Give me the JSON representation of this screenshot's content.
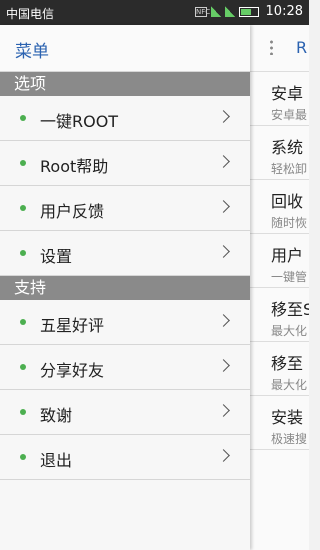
{
  "status_bar": {
    "carrier": "中国电信",
    "nfc": "NFC",
    "time": "10:28"
  },
  "drawer": {
    "title": "菜单",
    "sections": [
      {
        "label": "选项",
        "items": [
          "一键ROOT",
          "Root帮助",
          "用户反馈",
          "设置"
        ]
      },
      {
        "label": "支持",
        "items": [
          "五星好评",
          "分享好友",
          "致谢",
          "退出"
        ]
      }
    ]
  },
  "content": {
    "title": "R",
    "items": [
      {
        "title": "安卓",
        "subtitle": "安卓最"
      },
      {
        "title": "系统",
        "subtitle": "轻松卸"
      },
      {
        "title": "回收",
        "subtitle": "随时恢"
      },
      {
        "title": "用户",
        "subtitle": "一键管"
      },
      {
        "title": "移至S",
        "subtitle": "最大化"
      },
      {
        "title": "移至",
        "subtitle": "最大化"
      },
      {
        "title": "安装",
        "subtitle": "极速搜"
      }
    ]
  },
  "colors": {
    "accent": "#2b62b0",
    "bullet": "#4caf50",
    "section_bg": "#8a8a8a"
  }
}
